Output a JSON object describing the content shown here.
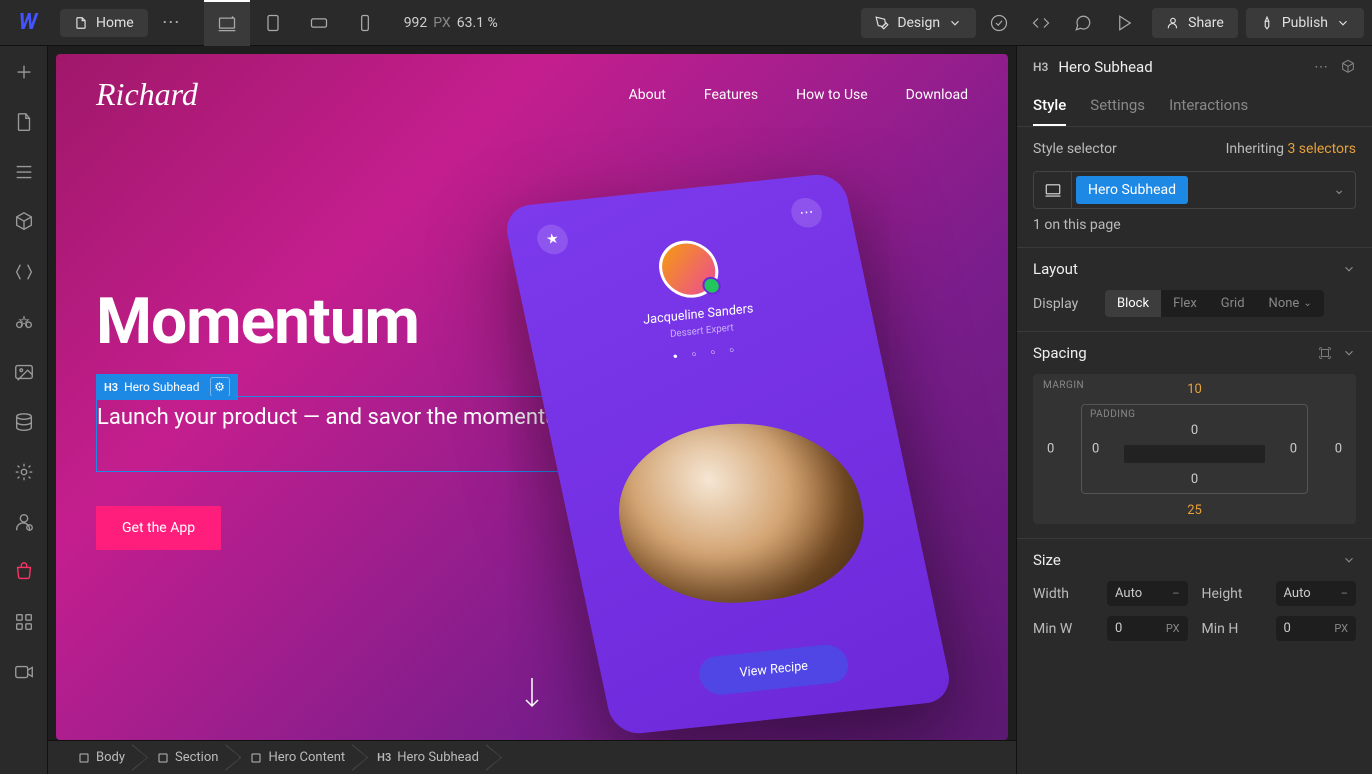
{
  "topbar": {
    "page_name": "Home",
    "canvas_width": "992",
    "canvas_unit": "PX",
    "zoom": "63.1 %",
    "mode": "Design",
    "share": "Share",
    "publish": "Publish"
  },
  "canvas": {
    "brand": "Richard",
    "nav": [
      "About",
      "Features",
      "How to Use",
      "Download"
    ],
    "hero_title": "Momentum",
    "sel_tag": "H3",
    "sel_label": "Hero Subhead",
    "hero_sub": "Launch your product — and savor the momentum.",
    "cta": "Get the App",
    "phone": {
      "name": "Jacqueline Sanders",
      "role": "Dessert Expert",
      "button": "View Recipe"
    }
  },
  "breadcrumb": [
    "Body",
    "Section",
    "Hero Content",
    "Hero Subhead"
  ],
  "panel": {
    "el_tag": "H3",
    "el_name": "Hero Subhead",
    "tabs": [
      "Style",
      "Settings",
      "Interactions"
    ],
    "style_selector_label": "Style selector",
    "inheriting": "Inheriting",
    "selectors_count": "3 selectors",
    "class_name": "Hero Subhead",
    "on_page": "1 on this page",
    "layout_title": "Layout",
    "display_label": "Display",
    "display_opts": [
      "Block",
      "Flex",
      "Grid",
      "None"
    ],
    "spacing_title": "Spacing",
    "margin_label": "MARGIN",
    "padding_label": "PADDING",
    "margin": {
      "top": "10",
      "right": "0",
      "bottom": "25",
      "left": "0"
    },
    "padding": {
      "top": "0",
      "right": "0",
      "bottom": "0",
      "left": "0"
    },
    "size_title": "Size",
    "size": {
      "width_label": "Width",
      "width_val": "Auto",
      "width_unit": "–",
      "height_label": "Height",
      "height_val": "Auto",
      "height_unit": "–",
      "minw_label": "Min W",
      "minw_val": "0",
      "minw_unit": "PX",
      "minh_label": "Min H",
      "minh_val": "0",
      "minh_unit": "PX"
    }
  }
}
